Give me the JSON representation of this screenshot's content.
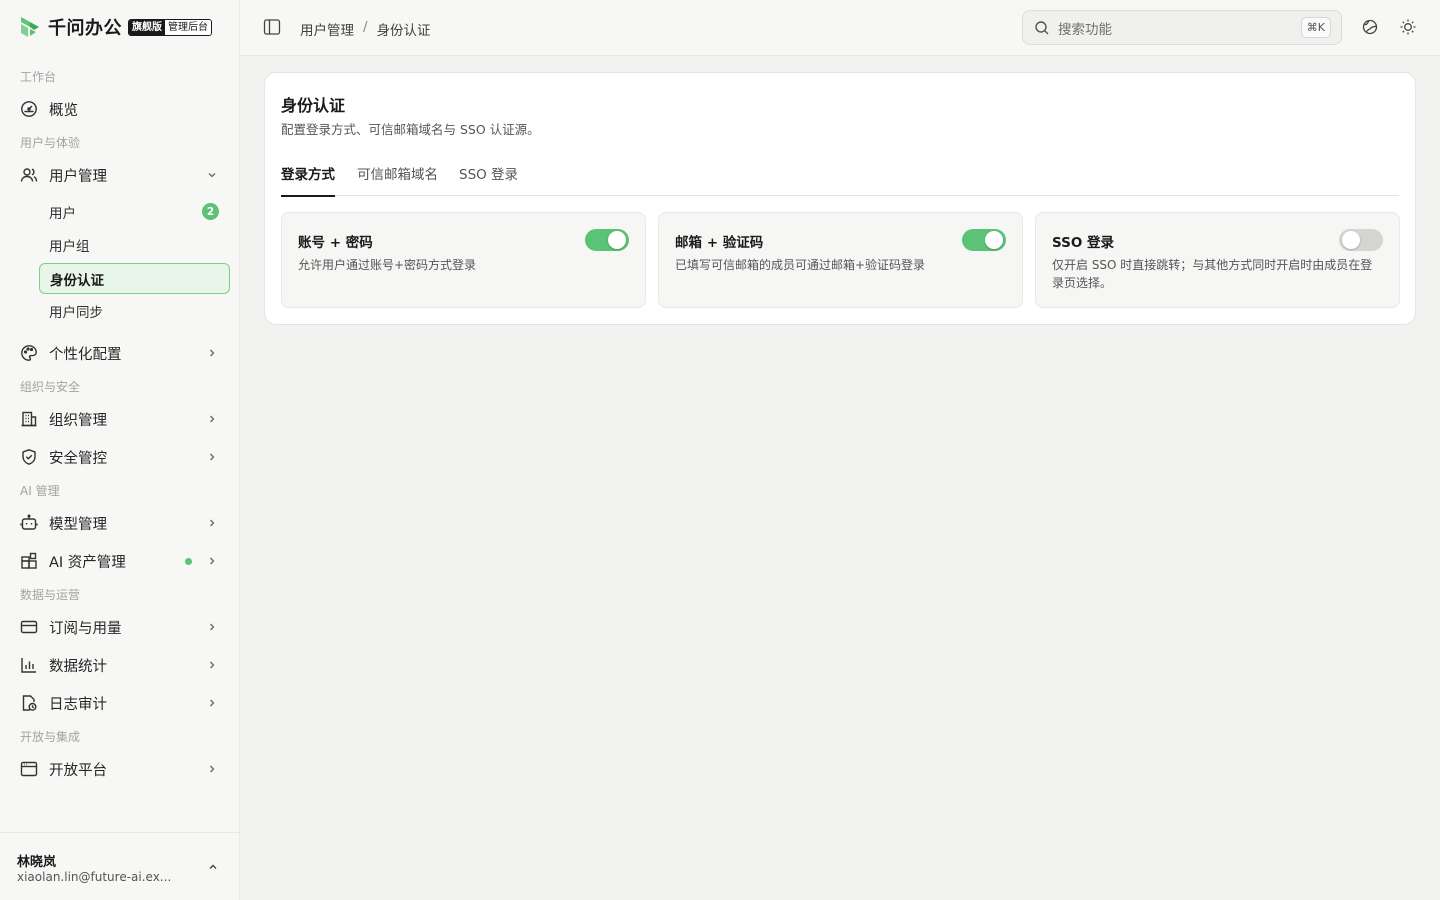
{
  "brand": {
    "name": "千问办公",
    "edition": "旗舰版",
    "console": "管理后台",
    "accent": "#5cc275"
  },
  "sidebar": {
    "sections": {
      "workspace": "工作台",
      "user_experience": "用户与体验",
      "org_security": "组织与安全",
      "ai": "AI 管理",
      "data_ops": "数据与运营",
      "open": "开放与集成"
    },
    "items": {
      "overview": "概览",
      "user_mgmt": "用户管理",
      "personalize": "个性化配置",
      "org_mgmt": "组织管理",
      "security": "安全管控",
      "model_mgmt": "模型管理",
      "ai_assets": "AI 资产管理",
      "subscription": "订阅与用量",
      "stats": "数据统计",
      "audit": "日志审计",
      "open_platform": "开放平台"
    },
    "sub_items": {
      "users": "用户",
      "users_count": "2",
      "groups": "用户组",
      "auth": "身份认证",
      "sync": "用户同步"
    },
    "user": {
      "name": "林晓岚",
      "email": "xiaolan.lin@future-ai.ex..."
    }
  },
  "header": {
    "breadcrumb": [
      "用户管理",
      "身份认证"
    ],
    "breadcrumb_sep": "/",
    "search_placeholder": "搜索功能",
    "search_shortcut": "⌘K"
  },
  "main": {
    "title": "身份认证",
    "description": "配置登录方式、可信邮箱域名与 SSO 认证源。",
    "tabs": [
      "登录方式",
      "可信邮箱域名",
      "SSO 登录"
    ],
    "active_tab": "登录方式",
    "options": [
      {
        "title": "账号 + 密码",
        "desc": "允许用户通过账号+密码方式登录",
        "enabled": true
      },
      {
        "title": "邮箱 + 验证码",
        "desc": "已填写可信邮箱的成员可通过邮箱+验证码登录",
        "enabled": true
      },
      {
        "title": "SSO 登录",
        "desc": "仅开启 SSO 时直接跳转；与其他方式同时开启时由成员在登录页选择。",
        "enabled": false
      }
    ]
  }
}
